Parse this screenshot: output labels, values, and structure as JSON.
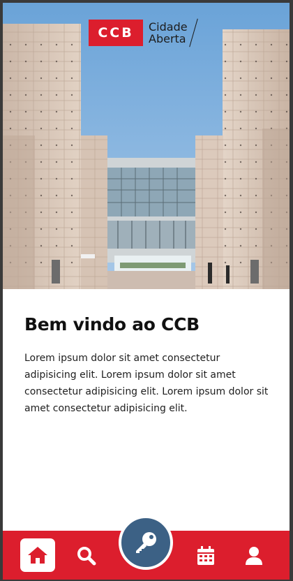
{
  "header": {
    "logo_mark": "CCB",
    "logo_line1": "Cidade",
    "logo_line2": "Aberta"
  },
  "main": {
    "title": "Bem vindo ao CCB",
    "body": "Lorem ipsum dolor sit amet consectetur adipisicing elit. Lorem ipsum dolor sit amet consectetur adipisicing elit. Lorem ipsum dolor sit amet consectetur adipisicing elit."
  },
  "bottom_nav": {
    "items": [
      {
        "name": "home",
        "icon": "home-icon",
        "active": true
      },
      {
        "name": "search",
        "icon": "search-icon",
        "active": false
      },
      {
        "name": "key",
        "icon": "key-icon",
        "active": false
      },
      {
        "name": "calendar",
        "icon": "calendar-icon",
        "active": false
      },
      {
        "name": "profile",
        "icon": "user-icon",
        "active": false
      }
    ]
  },
  "colors": {
    "brand_red": "#dc1e2d",
    "key_blue": "#3c6185",
    "text": "#111111"
  }
}
